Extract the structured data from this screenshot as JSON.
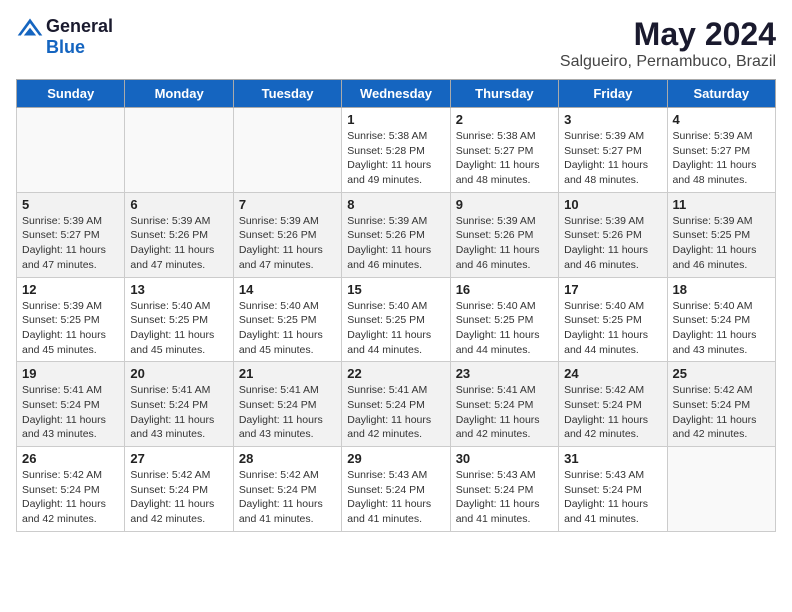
{
  "logo": {
    "general": "General",
    "blue": "Blue"
  },
  "title": "May 2024",
  "subtitle": "Salgueiro, Pernambuco, Brazil",
  "days_of_week": [
    "Sunday",
    "Monday",
    "Tuesday",
    "Wednesday",
    "Thursday",
    "Friday",
    "Saturday"
  ],
  "weeks": [
    [
      {
        "day": "",
        "info": ""
      },
      {
        "day": "",
        "info": ""
      },
      {
        "day": "",
        "info": ""
      },
      {
        "day": "1",
        "info": "Sunrise: 5:38 AM\nSunset: 5:28 PM\nDaylight: 11 hours\nand 49 minutes."
      },
      {
        "day": "2",
        "info": "Sunrise: 5:38 AM\nSunset: 5:27 PM\nDaylight: 11 hours\nand 48 minutes."
      },
      {
        "day": "3",
        "info": "Sunrise: 5:39 AM\nSunset: 5:27 PM\nDaylight: 11 hours\nand 48 minutes."
      },
      {
        "day": "4",
        "info": "Sunrise: 5:39 AM\nSunset: 5:27 PM\nDaylight: 11 hours\nand 48 minutes."
      }
    ],
    [
      {
        "day": "5",
        "info": "Sunrise: 5:39 AM\nSunset: 5:27 PM\nDaylight: 11 hours\nand 47 minutes."
      },
      {
        "day": "6",
        "info": "Sunrise: 5:39 AM\nSunset: 5:26 PM\nDaylight: 11 hours\nand 47 minutes."
      },
      {
        "day": "7",
        "info": "Sunrise: 5:39 AM\nSunset: 5:26 PM\nDaylight: 11 hours\nand 47 minutes."
      },
      {
        "day": "8",
        "info": "Sunrise: 5:39 AM\nSunset: 5:26 PM\nDaylight: 11 hours\nand 46 minutes."
      },
      {
        "day": "9",
        "info": "Sunrise: 5:39 AM\nSunset: 5:26 PM\nDaylight: 11 hours\nand 46 minutes."
      },
      {
        "day": "10",
        "info": "Sunrise: 5:39 AM\nSunset: 5:26 PM\nDaylight: 11 hours\nand 46 minutes."
      },
      {
        "day": "11",
        "info": "Sunrise: 5:39 AM\nSunset: 5:25 PM\nDaylight: 11 hours\nand 46 minutes."
      }
    ],
    [
      {
        "day": "12",
        "info": "Sunrise: 5:39 AM\nSunset: 5:25 PM\nDaylight: 11 hours\nand 45 minutes."
      },
      {
        "day": "13",
        "info": "Sunrise: 5:40 AM\nSunset: 5:25 PM\nDaylight: 11 hours\nand 45 minutes."
      },
      {
        "day": "14",
        "info": "Sunrise: 5:40 AM\nSunset: 5:25 PM\nDaylight: 11 hours\nand 45 minutes."
      },
      {
        "day": "15",
        "info": "Sunrise: 5:40 AM\nSunset: 5:25 PM\nDaylight: 11 hours\nand 44 minutes."
      },
      {
        "day": "16",
        "info": "Sunrise: 5:40 AM\nSunset: 5:25 PM\nDaylight: 11 hours\nand 44 minutes."
      },
      {
        "day": "17",
        "info": "Sunrise: 5:40 AM\nSunset: 5:25 PM\nDaylight: 11 hours\nand 44 minutes."
      },
      {
        "day": "18",
        "info": "Sunrise: 5:40 AM\nSunset: 5:24 PM\nDaylight: 11 hours\nand 43 minutes."
      }
    ],
    [
      {
        "day": "19",
        "info": "Sunrise: 5:41 AM\nSunset: 5:24 PM\nDaylight: 11 hours\nand 43 minutes."
      },
      {
        "day": "20",
        "info": "Sunrise: 5:41 AM\nSunset: 5:24 PM\nDaylight: 11 hours\nand 43 minutes."
      },
      {
        "day": "21",
        "info": "Sunrise: 5:41 AM\nSunset: 5:24 PM\nDaylight: 11 hours\nand 43 minutes."
      },
      {
        "day": "22",
        "info": "Sunrise: 5:41 AM\nSunset: 5:24 PM\nDaylight: 11 hours\nand 42 minutes."
      },
      {
        "day": "23",
        "info": "Sunrise: 5:41 AM\nSunset: 5:24 PM\nDaylight: 11 hours\nand 42 minutes."
      },
      {
        "day": "24",
        "info": "Sunrise: 5:42 AM\nSunset: 5:24 PM\nDaylight: 11 hours\nand 42 minutes."
      },
      {
        "day": "25",
        "info": "Sunrise: 5:42 AM\nSunset: 5:24 PM\nDaylight: 11 hours\nand 42 minutes."
      }
    ],
    [
      {
        "day": "26",
        "info": "Sunrise: 5:42 AM\nSunset: 5:24 PM\nDaylight: 11 hours\nand 42 minutes."
      },
      {
        "day": "27",
        "info": "Sunrise: 5:42 AM\nSunset: 5:24 PM\nDaylight: 11 hours\nand 42 minutes."
      },
      {
        "day": "28",
        "info": "Sunrise: 5:42 AM\nSunset: 5:24 PM\nDaylight: 11 hours\nand 41 minutes."
      },
      {
        "day": "29",
        "info": "Sunrise: 5:43 AM\nSunset: 5:24 PM\nDaylight: 11 hours\nand 41 minutes."
      },
      {
        "day": "30",
        "info": "Sunrise: 5:43 AM\nSunset: 5:24 PM\nDaylight: 11 hours\nand 41 minutes."
      },
      {
        "day": "31",
        "info": "Sunrise: 5:43 AM\nSunset: 5:24 PM\nDaylight: 11 hours\nand 41 minutes."
      },
      {
        "day": "",
        "info": ""
      }
    ]
  ]
}
